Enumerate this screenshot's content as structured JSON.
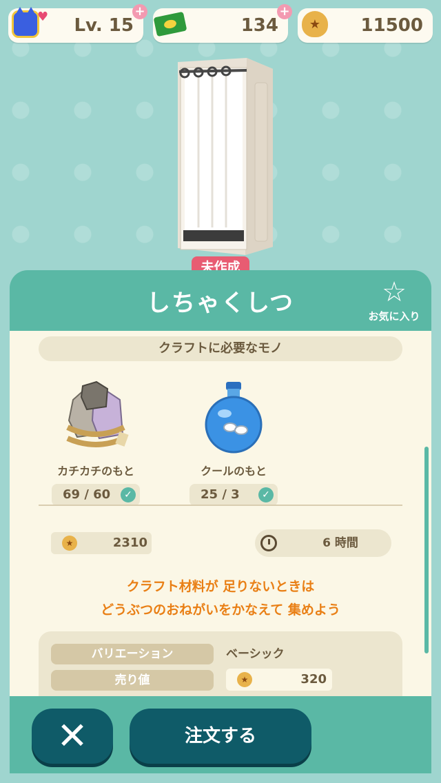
{
  "status_bar": {
    "level": "Lv. 15",
    "tickets": "134",
    "bells": "11500"
  },
  "item": {
    "status_tag": "未作成",
    "name": "しちゃくしつ",
    "favorite_label": "お気に入り"
  },
  "craft": {
    "section_title": "クラフトに必要なモノ",
    "materials": [
      {
        "name": "カチカチのもと",
        "count": "69 / 60"
      },
      {
        "name": "クールのもと",
        "count": "25 / 3"
      }
    ],
    "bell_cost": "2310",
    "time": "6 時間",
    "hint_line1": "クラフト材料が 足りないときは",
    "hint_line2": "どうぶつのおねがいをかなえて 集めよう"
  },
  "details": {
    "variation_label": "バリエーション",
    "variation_value": "ベーシック",
    "sell_label": "売り値",
    "sell_value": "320"
  },
  "footer": {
    "order_label": "注文する"
  },
  "colors": {
    "background": "#9fd5cf",
    "header": "#5ab8a5",
    "button": "#0f5b68",
    "tag": "#e85c72",
    "hint": "#e97f15"
  }
}
